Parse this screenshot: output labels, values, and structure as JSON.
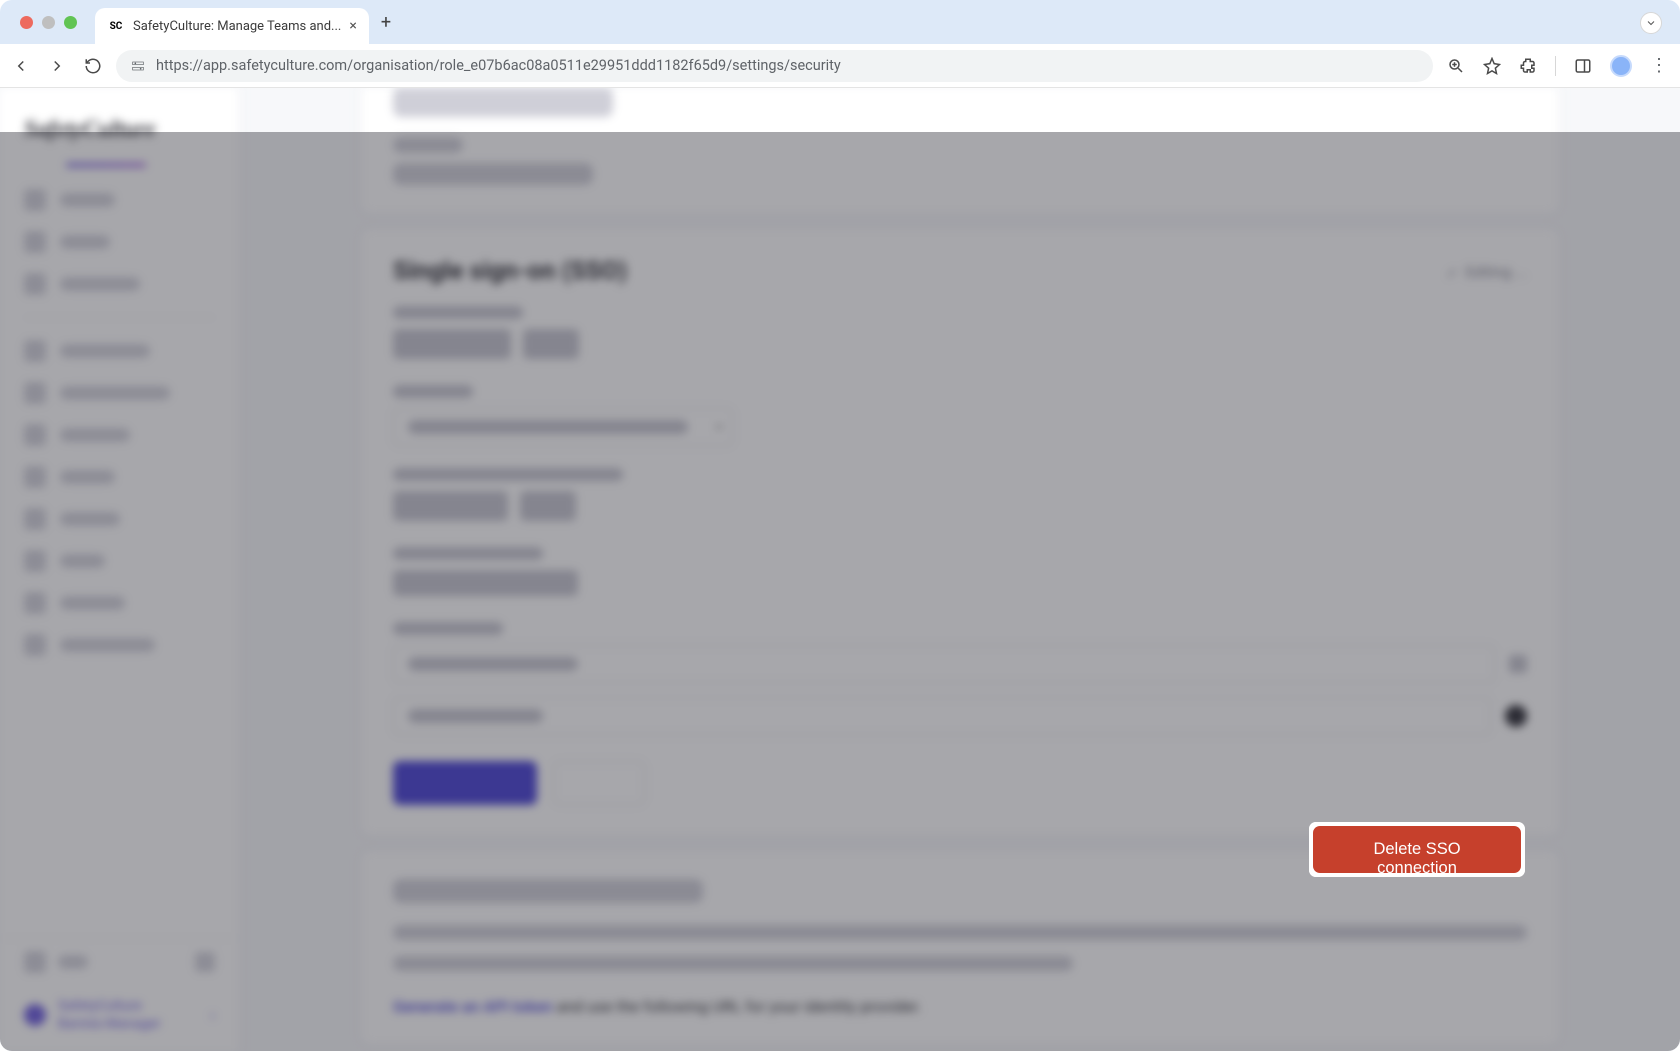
{
  "browser": {
    "tab_title": "SafetyCulture: Manage Teams and...",
    "url": "https://app.safetyculture.com/organisation/role_e07b6ac08a0511e29951ddd1182f65d9/settings/security"
  },
  "app": {
    "logo_text": "SafetyCulture",
    "org_name_line1": "SafetyCulture",
    "org_name_line2": "Barista Manager"
  },
  "sso_section": {
    "title": "Single sign-on (SSO)",
    "editing_label": "Editing ...",
    "delete_label": "Delete SSO connection"
  },
  "scim_section": {
    "footer_text_prefix": "Generate an ",
    "footer_link": "API token",
    "footer_text_suffix": " and use the following URL for your identity provider."
  },
  "colors": {
    "primary": "#4740d4",
    "danger": "#c6402c",
    "overlay": "rgba(45,45,55,0.42)"
  }
}
